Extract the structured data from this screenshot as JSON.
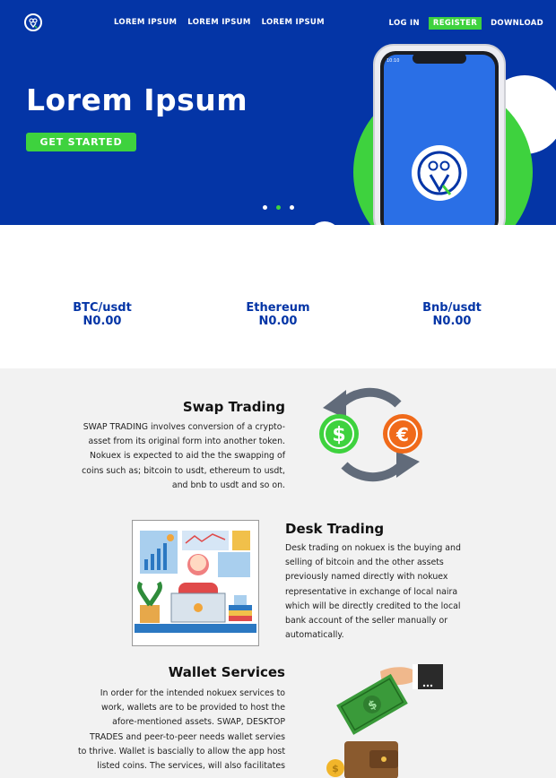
{
  "nav": {
    "links": [
      "LOREM IPSUM",
      "LOREM IPSUM",
      "LOREM IPSUM"
    ],
    "login": "LOG IN",
    "register": "REGISTER",
    "download": "DOWNLOAD"
  },
  "hero": {
    "title": "Lorem Ipsum",
    "cta": "GET STARTED",
    "slide_count": 3,
    "active_slide": 2
  },
  "ticker": [
    {
      "pair": "BTC/usdt",
      "price": "N0.00"
    },
    {
      "pair": "Ethereum",
      "price": "N0.00"
    },
    {
      "pair": "Bnb/usdt",
      "price": "N0.00"
    }
  ],
  "features": {
    "swap": {
      "title": "Swap Trading",
      "lines": [
        "SWAP TRADING involves conversion of a crypto-",
        "asset from its original form into another token.",
        "Nokuex is expected to aid the the swapping of",
        "coins such as; bitcoin to usdt, ethereum to usdt,",
        "and bnb to usdt and so on."
      ]
    },
    "desk": {
      "title": "Desk Trading",
      "lines": [
        "Desk trading on nokuex is the buying and",
        "selling of bitcoin and the other assets",
        "previously named directly with nokuex",
        "representative in exchange of local naira",
        "which will be directly credited to the local",
        "bank account of the seller manually or",
        "automatically."
      ]
    },
    "wallet": {
      "title": "Wallet Services",
      "lines": [
        "In order for the intended nokuex services to",
        "work, wallets are to be provided to host the",
        "afore-mentioned assets. SWAP, DESKTOP",
        "TRADES and peer-to-peer needs wallet servies",
        "to thrive. Wallet is bascially to allow the app host",
        "listed coins. The services, will also facilitates"
      ]
    }
  },
  "colors": {
    "brand_blue": "#0435a6",
    "accent_green": "#3ed23e",
    "orange": "#f06a1a"
  },
  "icons": {
    "logo": "owl-logo-icon",
    "swap": "currency-swap-icon",
    "desk": "desk-trader-illustration",
    "wallet": "wallet-cash-icon"
  }
}
